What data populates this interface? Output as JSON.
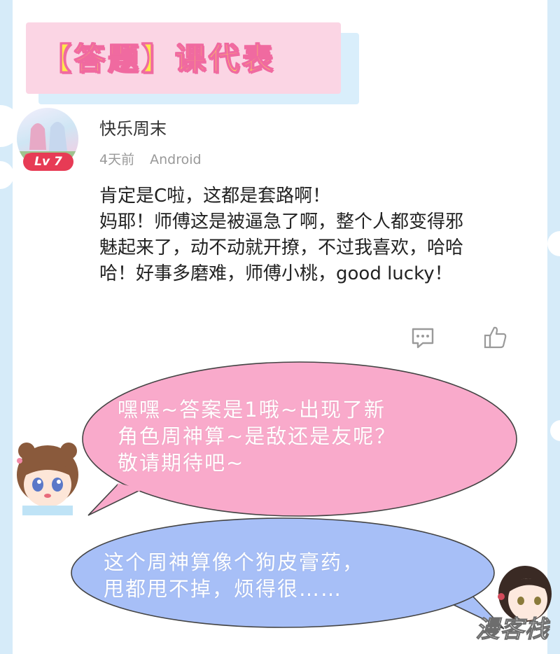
{
  "banner": {
    "title": "【答题】课代表"
  },
  "comment": {
    "username": "快乐周末",
    "level": "Lv 7",
    "time": "4天前",
    "platform": "Android",
    "lines": [
      "肯定是C啦，这都是套路啊！",
      "妈耶！师傅这是被逼急了啊，整个人都变得邪",
      "魅起来了，动不动就开撩，不过我喜欢，哈哈",
      "哈！好事多磨难，师傅小桃，good lucky！"
    ],
    "actions": {
      "reply_icon": "comment-icon",
      "like_icon": "thumbs-up-icon"
    }
  },
  "bubbles": {
    "pink": {
      "lines": [
        "嘿嘿~答案是1哦~出现了新",
        "角色周神算~是敌还是友呢？",
        "敬请期待吧~"
      ],
      "color": "#f9aacb"
    },
    "blue": {
      "lines": [
        "这个周神算像个狗皮膏药，",
        "甩都甩不掉，烦得很……"
      ],
      "color": "#a7bff7"
    }
  },
  "watermark": {
    "text": "漫客栈"
  },
  "colors": {
    "page_bg": "#d6ebf9",
    "banner_bg": "#fbd5e4",
    "banner_text": "#ffe94a",
    "banner_outline": "#f06aa0",
    "level_badge": "#e73b55"
  }
}
